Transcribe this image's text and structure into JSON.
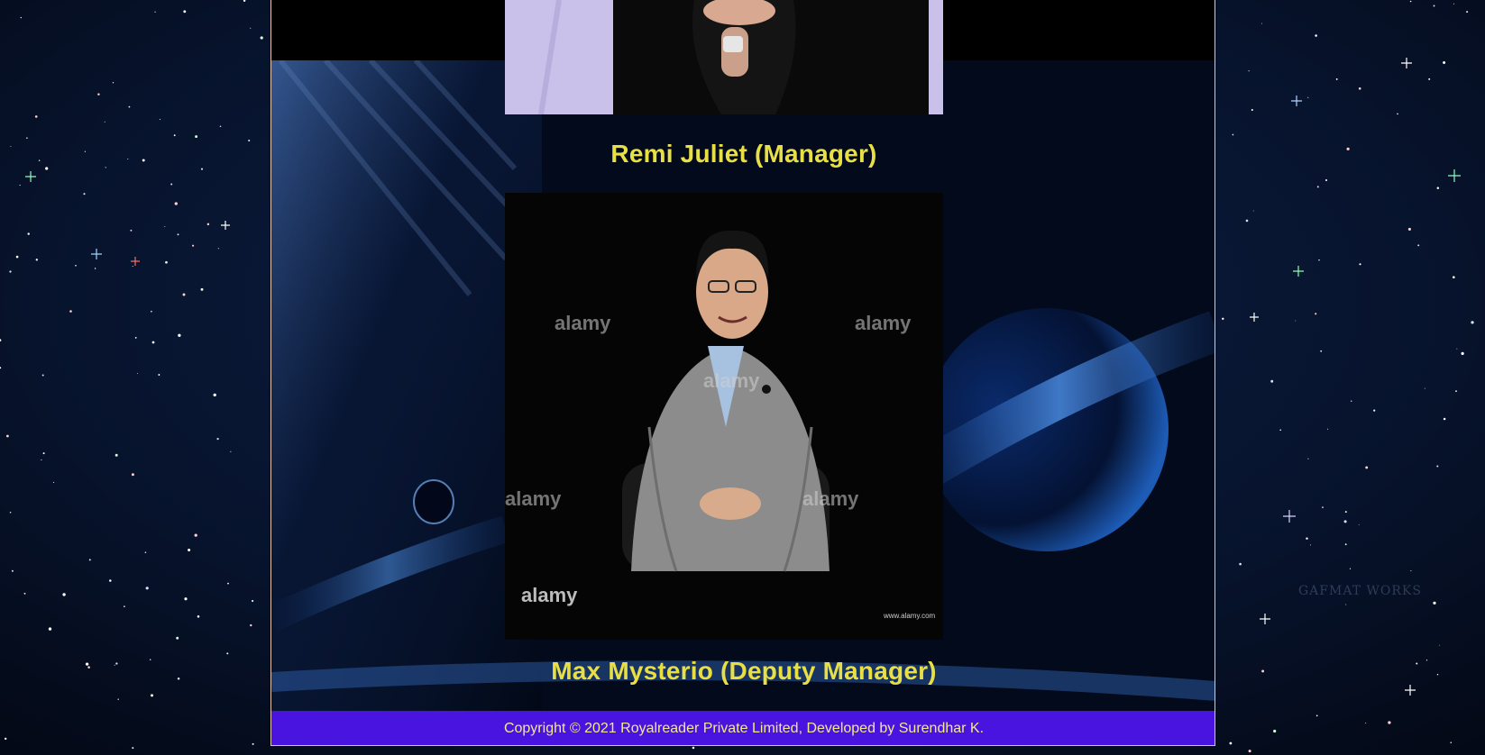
{
  "staff": [
    {
      "name_role": "Remi Juliet (Manager)"
    },
    {
      "name_role": "Max Mysterio (Deputy Manager)"
    }
  ],
  "photo_watermark": {
    "brand": "alamy",
    "site": "www.alamy.com"
  },
  "background_watermark": "GAFMAT WORKS",
  "footer": {
    "copyright": "Copyright © 2021 Royalreader Private Limited, Developed by Surendhar K."
  },
  "colors": {
    "caption": "#e8df45",
    "footer_bg": "#4a14e0",
    "footer_text": "#f2e98f",
    "page_border": "#e7c6b0"
  }
}
